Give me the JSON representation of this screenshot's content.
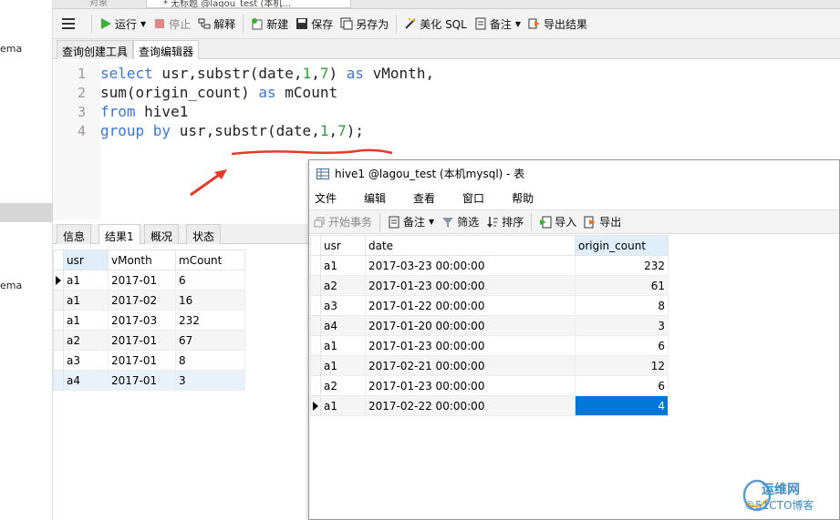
{
  "left_panel": {
    "items": [
      "ema",
      "ema"
    ]
  },
  "top_tabs": [
    {
      "label": "对象"
    },
    {
      "label": "* 无标题 @lagou_test (本机..."
    }
  ],
  "toolbar": {
    "run": "运行",
    "stop": "停止",
    "explain": "解释",
    "new": "新建",
    "save": "保存",
    "save_as": "另存为",
    "beautify": "美化 SQL",
    "note": "备注",
    "export": "导出结果"
  },
  "subtabs": {
    "builder": "查询创建工具",
    "editor": "查询编辑器"
  },
  "editor": {
    "line_numbers": [
      "1",
      "2",
      "3",
      "4"
    ],
    "lines": [
      [
        [
          "kw",
          "select"
        ],
        [
          "t",
          " usr,substr(date,"
        ],
        [
          "num",
          "1"
        ],
        [
          "t",
          ","
        ],
        [
          "num",
          "7"
        ],
        [
          "t",
          ") "
        ],
        [
          "kw",
          "as"
        ],
        [
          "t",
          " vMonth,"
        ]
      ],
      [
        [
          "t",
          "sum(origin_count) "
        ],
        [
          "kw",
          "as"
        ],
        [
          "t",
          " mCount"
        ]
      ],
      [
        [
          "kw",
          "from"
        ],
        [
          "t",
          " hive1"
        ]
      ],
      [
        [
          "kw",
          "group by"
        ],
        [
          "t",
          " usr,substr(date,"
        ],
        [
          "num",
          "1"
        ],
        [
          "t",
          ","
        ],
        [
          "num",
          "7"
        ],
        [
          "t",
          ");"
        ]
      ]
    ]
  },
  "result_tabs": [
    "信息",
    "结果1",
    "概况",
    "状态"
  ],
  "result1": {
    "columns": [
      "usr",
      "vMonth",
      "mCount"
    ],
    "rows": [
      [
        "a1",
        "2017-01",
        "6"
      ],
      [
        "a1",
        "2017-02",
        "16"
      ],
      [
        "a1",
        "2017-03",
        "232"
      ],
      [
        "a2",
        "2017-01",
        "67"
      ],
      [
        "a3",
        "2017-01",
        "8"
      ],
      [
        "a4",
        "2017-01",
        "3"
      ]
    ]
  },
  "table_window": {
    "title": "hive1 @lagou_test (本机mysql) - 表",
    "menu": [
      "文件",
      "编辑",
      "查看",
      "窗口",
      "帮助"
    ],
    "tools": {
      "begin_tx": "开始事务",
      "note": "备注",
      "filter": "筛选",
      "sort": "排序",
      "import": "导入",
      "export": "导出"
    },
    "columns": [
      "usr",
      "date",
      "origin_count"
    ],
    "rows": [
      [
        "a1",
        "2017-03-23 00:00:00",
        "232"
      ],
      [
        "a2",
        "2017-01-23 00:00:00",
        "61"
      ],
      [
        "a3",
        "2017-01-22 00:00:00",
        "8"
      ],
      [
        "a4",
        "2017-01-20 00:00:00",
        "3"
      ],
      [
        "a1",
        "2017-01-23 00:00:00",
        "6"
      ],
      [
        "a1",
        "2017-02-21 00:00:00",
        "12"
      ],
      [
        "a2",
        "2017-01-23 00:00:00",
        "6"
      ],
      [
        "a1",
        "2017-02-22 00:00:00",
        "4"
      ]
    ]
  },
  "watermark": {
    "line1": "运维网",
    "line2": "©51CTO博客"
  },
  "colors": {
    "keyword": "#3a77d8",
    "number": "#2e9f3a",
    "selection": "#0078d7",
    "annotation": "#e8382a"
  }
}
